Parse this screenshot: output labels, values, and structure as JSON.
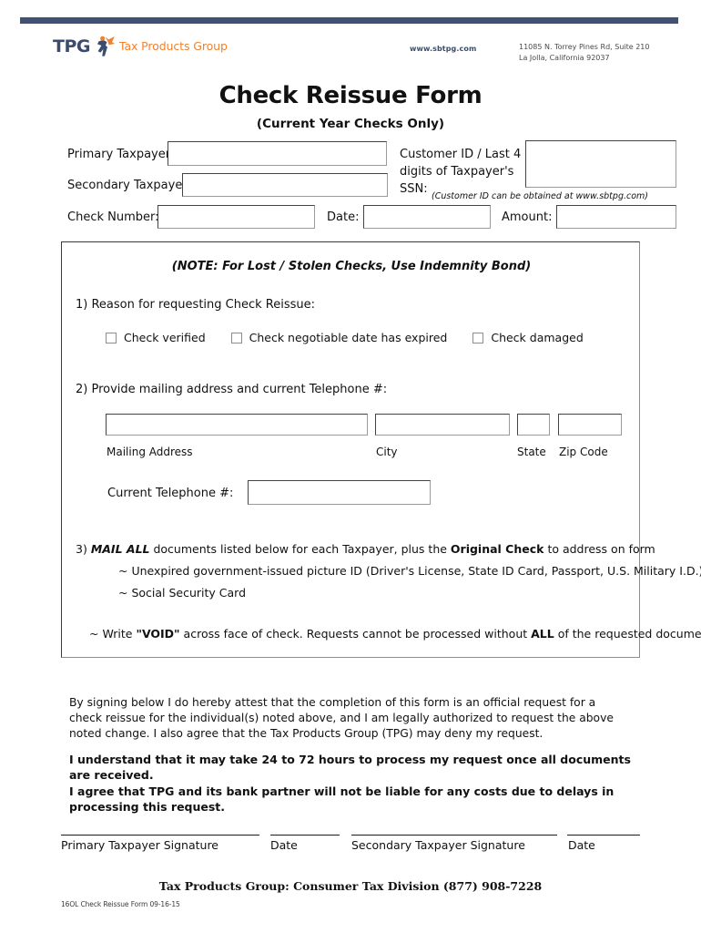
{
  "letterhead": {
    "logo_tpg": "TPG",
    "logo_tagline": "Tax Products Group",
    "website": "www.sbtpg.com",
    "address_line1": "11085 N. Torrey Pines Rd, Suite 210",
    "address_line2": "La Jolla, California 92037",
    "accent_navy": "#415173",
    "accent_orange": "#ef8230"
  },
  "title": {
    "main": "Check Reissue Form",
    "sub": "(Current Year Checks Only)"
  },
  "identity": {
    "primary_label": "Primary Taxpayer:",
    "primary_value": "",
    "secondary_label": "Secondary Taxpayer:",
    "secondary_value": "",
    "customer_id_label": "Customer ID / Last 4 digits of Taxpayer's SSN:",
    "customer_id_value": "",
    "customer_id_note": "(Customer ID can be obtained at www.sbtpg.com)",
    "check_number_label": "Check Number:",
    "check_number_value": "",
    "date_label": "Date:",
    "date_value": "",
    "amount_label": "Amount:",
    "amount_value": ""
  },
  "panel": {
    "note": "(NOTE: For Lost / Stolen Checks, Use Indemnity Bond)",
    "step1_label": "1)  Reason for requesting Check Reissue:",
    "reasons": [
      {
        "label": "Check verified",
        "checked": false
      },
      {
        "label": "Check negotiable date has expired",
        "checked": false
      },
      {
        "label": "Check damaged",
        "checked": false
      }
    ],
    "step2_label": "2)  Provide mailing address and current Telephone #:",
    "address": {
      "mailing_label": "Mailing Address",
      "mailing_value": "",
      "city_label": "City",
      "city_value": "",
      "state_label": "State",
      "state_value": "",
      "zip_label": "Zip Code",
      "zip_value": ""
    },
    "phone_label": "Current Telephone #:",
    "phone_value": "",
    "step3": {
      "head_prefix": "3) ",
      "head_em": "MAIL ALL",
      "head_mid": " documents listed below for each Taxpayer, plus the ",
      "head_strong": "Original Check",
      "head_suffix": " to address on form",
      "bullet1": "~ Unexpired government-issued picture ID (Driver's License, State ID Card, Passport, U.S. Military I.D.)",
      "bullet2": "~ Social Security Card",
      "void_prefix": "~  Write ",
      "void_strong": "\"VOID\"",
      "void_mid": " across face of check.  Requests cannot be processed without ",
      "void_strong2": "ALL",
      "void_suffix": " of the requested documents."
    }
  },
  "attestation": {
    "paragraph": "By signing below I do hereby attest that the completion of this form is an official request for a check reissue for the individual(s) noted above, and I am legally authorized to request the above noted change. I also agree that the Tax Products Group (TPG) may deny my request.",
    "bold_line1": "I understand that it may take 24 to 72 hours to process my request once all documents are received.",
    "bold_line2": "I agree that TPG and its bank partner will not be liable for any costs due to delays in processing this request."
  },
  "signatures": {
    "primary_label": "Primary Taxpayer Signature",
    "primary_date_label": "Date",
    "secondary_label": "Secondary Taxpayer Signature",
    "secondary_date_label": "Date"
  },
  "footer": {
    "contact": "Tax Products Group: Consumer Tax Division   (877) 908-7228",
    "form_code": "16OL Check Reissue Form 09-16-15"
  }
}
